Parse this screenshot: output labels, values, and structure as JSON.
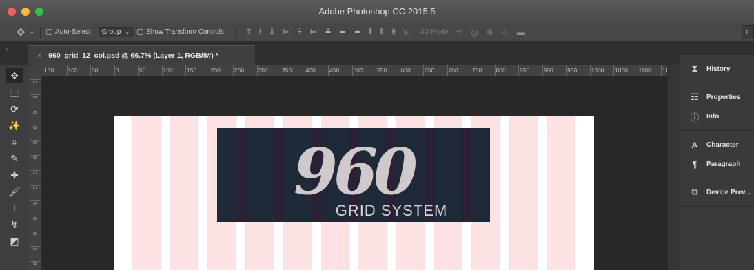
{
  "app": {
    "title": "Adobe Photoshop CC 2015.5"
  },
  "options": {
    "tool_icon": "move-icon",
    "auto_select_label": "Auto-Select:",
    "auto_select_value": "Group",
    "transform_label": "Show Transform Controls",
    "mode3d_label": "3D Mode:",
    "right_label": "E"
  },
  "document": {
    "tab_title": "960_grid_12_col.psd @ 66.7% (Layer 1, RGB/8#) *",
    "logo_number": "960",
    "logo_subtitle": "GRID SYSTEM",
    "column_count": 12,
    "colors": {
      "column": "#fde2e3",
      "banner": "#2c2037",
      "banner_column": "#1e2a38"
    }
  },
  "ruler": {
    "h_labels": [
      "150",
      "100",
      "50",
      "0",
      "50",
      "100",
      "150",
      "200",
      "250",
      "300",
      "350",
      "400",
      "450",
      "500",
      "550",
      "600",
      "650",
      "700",
      "750",
      "800",
      "850",
      "900",
      "950",
      "1000",
      "1050",
      "1100",
      "11"
    ],
    "v_labels": [
      "0",
      "5",
      "0",
      "0",
      "5",
      "0",
      "0",
      "0",
      "5",
      "0",
      "0",
      "3",
      "0"
    ]
  },
  "tools": [
    {
      "name": "move-tool-icon",
      "glyph": "✥"
    },
    {
      "name": "marquee-tool-icon",
      "glyph": "⬚"
    },
    {
      "name": "lasso-tool-icon",
      "glyph": "⟳"
    },
    {
      "name": "magic-wand-tool-icon",
      "glyph": "✨"
    },
    {
      "name": "crop-tool-icon",
      "glyph": "⌗"
    },
    {
      "name": "eyedropper-tool-icon",
      "glyph": "✎"
    },
    {
      "name": "healing-brush-tool-icon",
      "glyph": "✚"
    },
    {
      "name": "brush-tool-icon",
      "glyph": "🖌"
    },
    {
      "name": "stamp-tool-icon",
      "glyph": "⊥"
    },
    {
      "name": "history-brush-tool-icon",
      "glyph": "↯"
    },
    {
      "name": "eraser-tool-icon",
      "glyph": "◩"
    }
  ],
  "panels": {
    "group1": [
      {
        "label": "History",
        "icon": "history-icon",
        "glyph": "⧗"
      }
    ],
    "group2": [
      {
        "label": "Properties",
        "icon": "properties-icon",
        "glyph": "☷"
      },
      {
        "label": "Info",
        "icon": "info-icon",
        "glyph": "ⓘ"
      }
    ],
    "group3": [
      {
        "label": "Character",
        "icon": "character-icon",
        "glyph": "A"
      },
      {
        "label": "Paragraph",
        "icon": "paragraph-icon",
        "glyph": "¶"
      }
    ],
    "group4": [
      {
        "label": "Device Prev...",
        "icon": "device-preview-icon",
        "glyph": "⧉"
      }
    ]
  }
}
